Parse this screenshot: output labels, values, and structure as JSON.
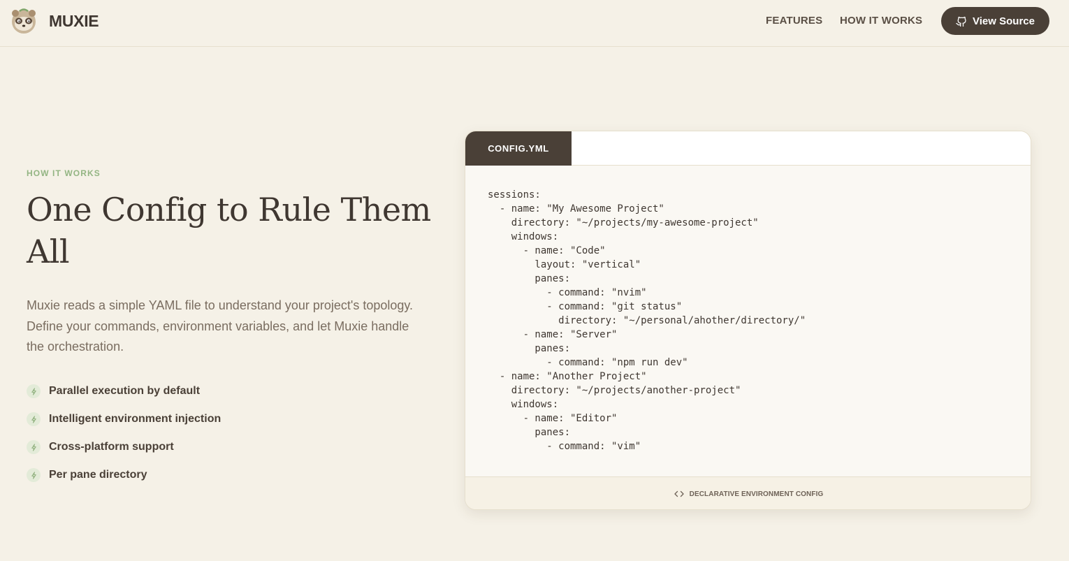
{
  "header": {
    "brand": "MUXIE",
    "nav": {
      "features": "FEATURES",
      "how_it_works": "HOW IT WORKS"
    },
    "view_source": "View Source"
  },
  "hero": {
    "eyebrow": "HOW IT WORKS",
    "headline": "One Config to Rule Them All",
    "lead": "Muxie reads a simple YAML file to understand your project's topology. Define your commands, environment variables, and let Muxie handle the orchestration.",
    "features": [
      "Parallel execution by default",
      "Intelligent environment injection",
      "Cross-platform support",
      "Per pane directory"
    ]
  },
  "config_card": {
    "tab_label": "CONFIG.YML",
    "code": "sessions:\n  - name: \"My Awesome Project\"\n    directory: \"~/projects/my-awesome-project\"\n    windows:\n      - name: \"Code\"\n        layout: \"vertical\"\n        panes:\n          - command: \"nvim\"\n          - command: \"git status\"\n            directory: \"~/personal/ahother/directory/\"\n      - name: \"Server\"\n        panes:\n          - command: \"npm run dev\"\n  - name: \"Another Project\"\n    directory: \"~/projects/another-project\"\n    windows:\n      - name: \"Editor\"\n        panes:\n          - command: \"vim\"",
    "footer": "DECLARATIVE ENVIRONMENT CONFIG"
  },
  "colors": {
    "background": "#f5f1e7",
    "accent_green": "#93b583",
    "dark": "#4a4037"
  }
}
